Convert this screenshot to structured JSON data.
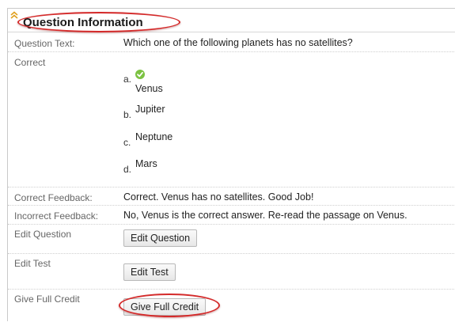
{
  "section": {
    "title": "Question Information",
    "collapse_icon": "double-chevron-up-icon",
    "highlight_color": "#d42a2a"
  },
  "question_text": {
    "label": "Question Text:",
    "value": "Which one of the following planets has no satellites?"
  },
  "correct": {
    "label": "Correct",
    "answers": [
      {
        "letter": "a.",
        "text": "Venus",
        "correct": true
      },
      {
        "letter": "b.",
        "text": "Jupiter",
        "correct": false
      },
      {
        "letter": "c.",
        "text": "Neptune",
        "correct": false
      },
      {
        "letter": "d.",
        "text": "Mars",
        "correct": false
      }
    ],
    "correct_icon": "check-circle-icon",
    "correct_icon_color": "#7cc242"
  },
  "correct_feedback": {
    "label": "Correct Feedback:",
    "value": "Correct. Venus has no satellites. Good Job!"
  },
  "incorrect_feedback": {
    "label": "Incorrect Feedback:",
    "value": "No, Venus is the correct answer. Re-read the passage on Venus."
  },
  "edit_question": {
    "label": "Edit Question",
    "button": "Edit Question"
  },
  "edit_test": {
    "label": "Edit Test",
    "button": "Edit Test"
  },
  "full_credit": {
    "label": "Give Full Credit",
    "button": "Give Full Credit"
  }
}
